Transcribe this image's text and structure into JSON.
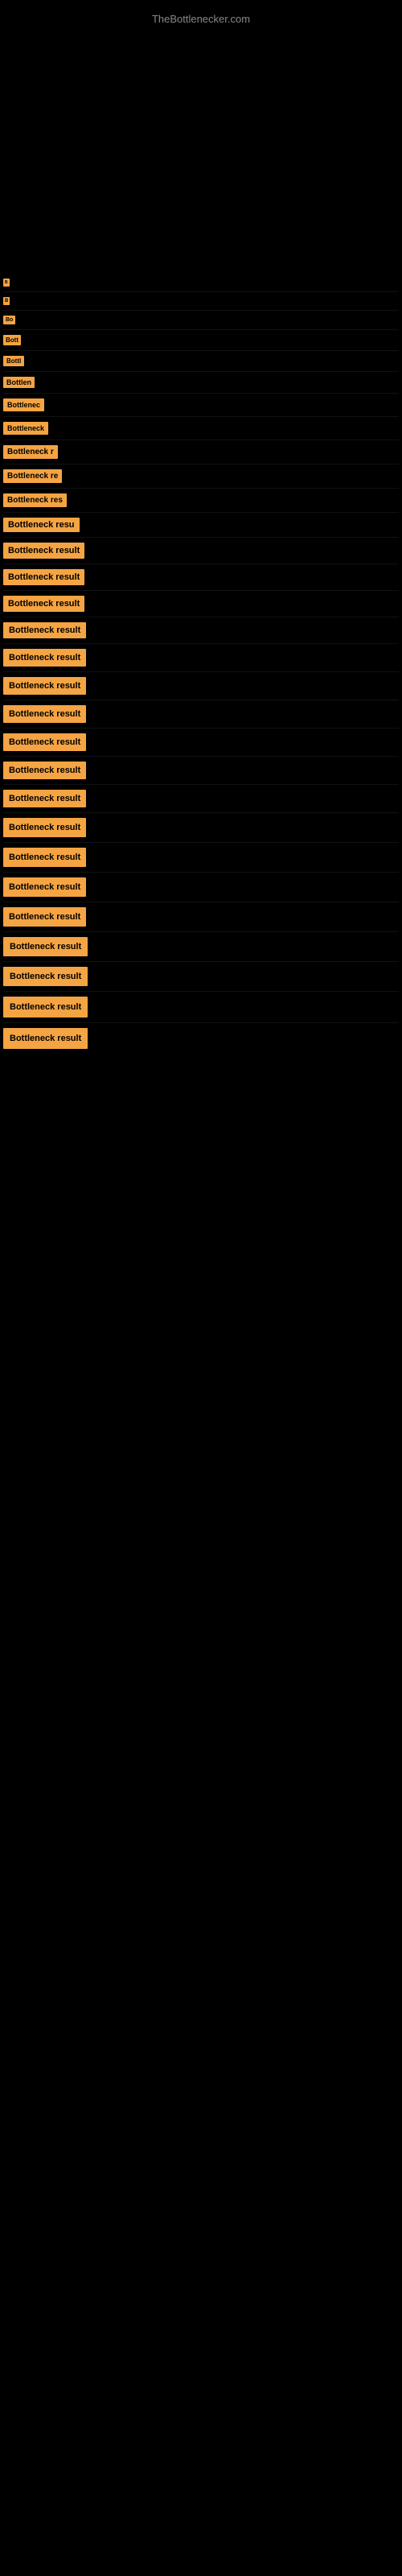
{
  "site": {
    "title": "TheBottlenecker.com"
  },
  "bars": [
    {
      "label": "B",
      "index": 1
    },
    {
      "label": "B",
      "index": 2
    },
    {
      "label": "Bo",
      "index": 3
    },
    {
      "label": "Bott",
      "index": 4
    },
    {
      "label": "Bottl",
      "index": 5
    },
    {
      "label": "Bottlen",
      "index": 6
    },
    {
      "label": "Bottlenec",
      "index": 7
    },
    {
      "label": "Bottleneck",
      "index": 8
    },
    {
      "label": "Bottleneck r",
      "index": 9
    },
    {
      "label": "Bottleneck re",
      "index": 10
    },
    {
      "label": "Bottleneck res",
      "index": 11
    },
    {
      "label": "Bottleneck resu",
      "index": 12
    },
    {
      "label": "Bottleneck result",
      "index": 13
    },
    {
      "label": "Bottleneck result",
      "index": 14
    },
    {
      "label": "Bottleneck result",
      "index": 15
    },
    {
      "label": "Bottleneck result",
      "index": 16
    },
    {
      "label": "Bottleneck result",
      "index": 17
    },
    {
      "label": "Bottleneck result",
      "index": 18
    },
    {
      "label": "Bottleneck result",
      "index": 19
    },
    {
      "label": "Bottleneck result",
      "index": 20
    },
    {
      "label": "Bottleneck result",
      "index": 21
    },
    {
      "label": "Bottleneck result",
      "index": 22
    },
    {
      "label": "Bottleneck result",
      "index": 23
    },
    {
      "label": "Bottleneck result",
      "index": 24
    },
    {
      "label": "Bottleneck result",
      "index": 25
    },
    {
      "label": "Bottleneck result",
      "index": 26
    },
    {
      "label": "Bottleneck result",
      "index": 27
    },
    {
      "label": "Bottleneck result",
      "index": 28
    },
    {
      "label": "Bottleneck result",
      "index": 29
    },
    {
      "label": "Bottleneck result",
      "index": 30
    }
  ]
}
